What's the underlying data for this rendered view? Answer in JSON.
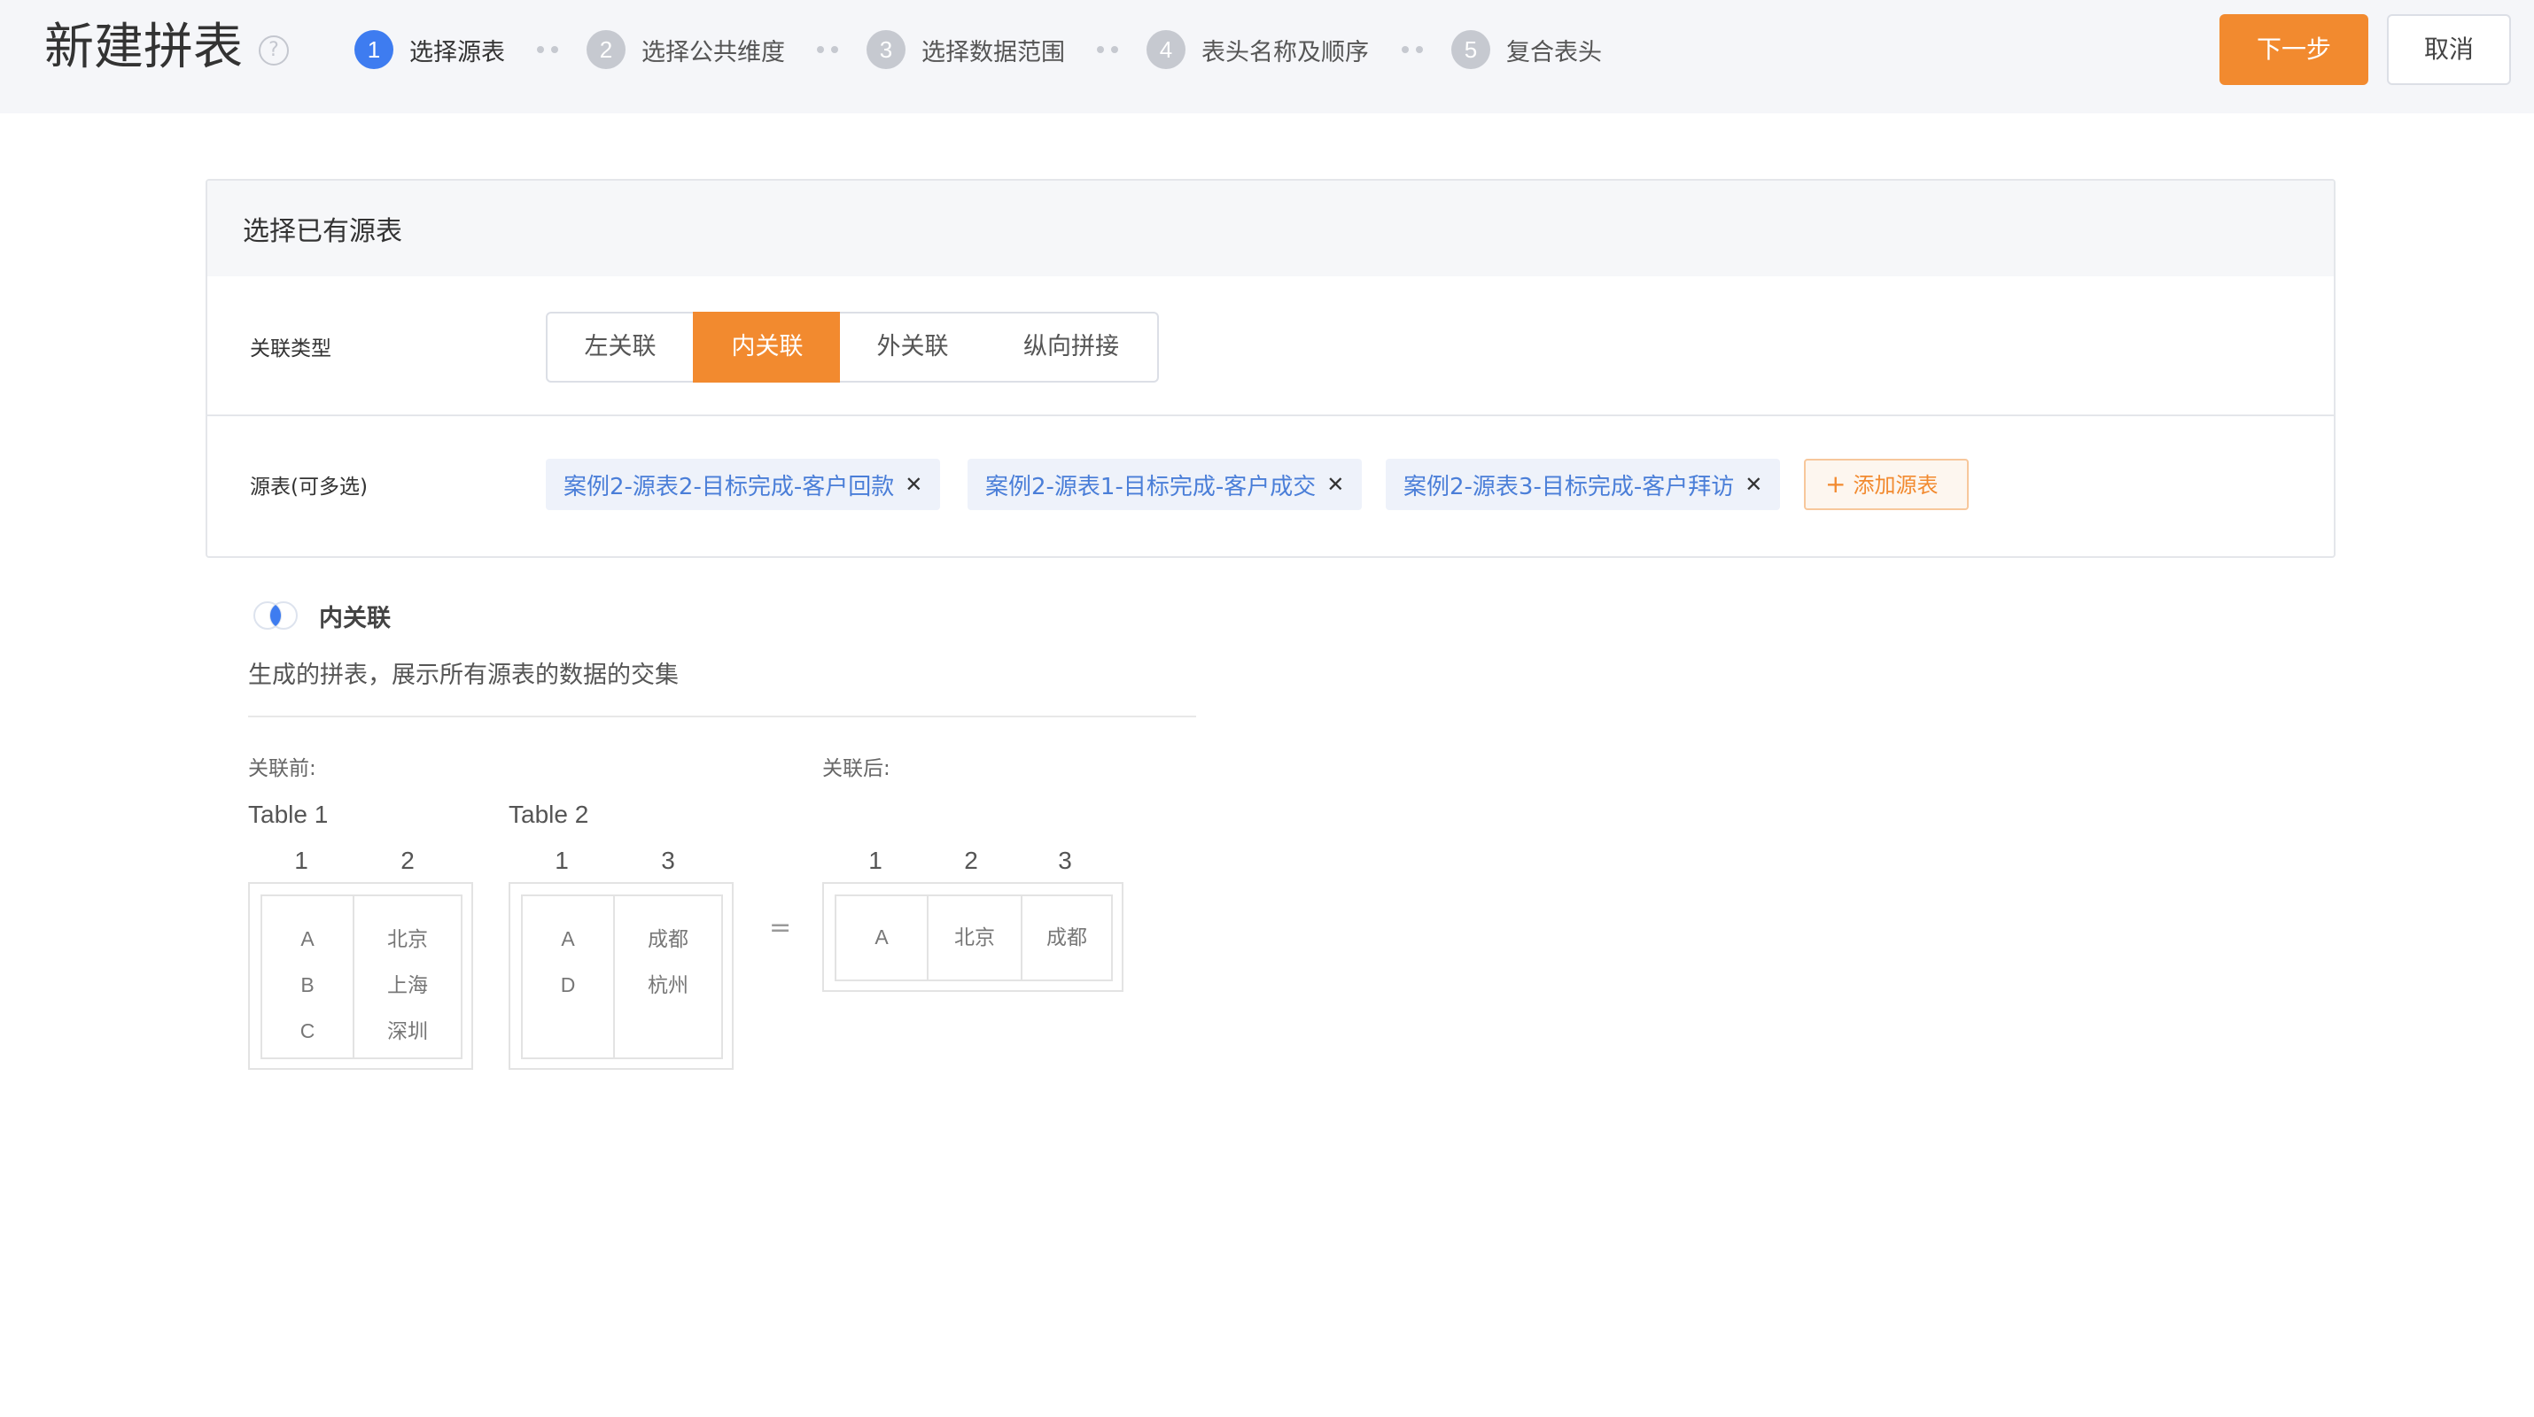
{
  "header": {
    "title": "新建拼表",
    "steps": [
      {
        "num": "1",
        "label": "选择源表"
      },
      {
        "num": "2",
        "label": "选择公共维度"
      },
      {
        "num": "3",
        "label": "选择数据范围"
      },
      {
        "num": "4",
        "label": "表头名称及顺序"
      },
      {
        "num": "5",
        "label": "复合表头"
      }
    ],
    "next_label": "下一步",
    "cancel_label": "取消"
  },
  "card": {
    "title": "选择已有源表",
    "join_type_label": "关联类型",
    "join_options": [
      "左关联",
      "内关联",
      "外关联",
      "纵向拼接"
    ],
    "selected_join": "内关联",
    "source_label": "源表(可多选)",
    "source_tags": [
      "案例2-源表2-目标完成-客户回款",
      "案例2-源表1-目标完成-客户成交",
      "案例2-源表3-目标完成-客户拜访"
    ],
    "add_source_label": "添加源表"
  },
  "explanation": {
    "title": "内关联",
    "description": "生成的拼表，展示所有源表的数据的交集",
    "before_label": "关联前:",
    "after_label": "关联后:",
    "equals": "=",
    "table1": {
      "name": "Table 1",
      "columns": [
        "1",
        "2"
      ],
      "col1": [
        "A",
        "B",
        "C"
      ],
      "col2": [
        "北京",
        "上海",
        "深圳"
      ]
    },
    "table2": {
      "name": "Table 2",
      "columns": [
        "1",
        "3"
      ],
      "col1": [
        "A",
        "D"
      ],
      "col2": [
        "成都",
        "杭州"
      ]
    },
    "result": {
      "columns": [
        "1",
        "2",
        "3"
      ],
      "row": [
        "A",
        "北京",
        "成都"
      ]
    }
  },
  "colors": {
    "accent_orange": "#f28a2f",
    "active_step_blue": "#3e7cf0",
    "tag_text_blue": "#4a7ed8"
  },
  "icons": {
    "help": "question-circle-icon",
    "tag_close": "close-icon",
    "add": "plus-icon",
    "join": "inner-join-venn-icon"
  }
}
